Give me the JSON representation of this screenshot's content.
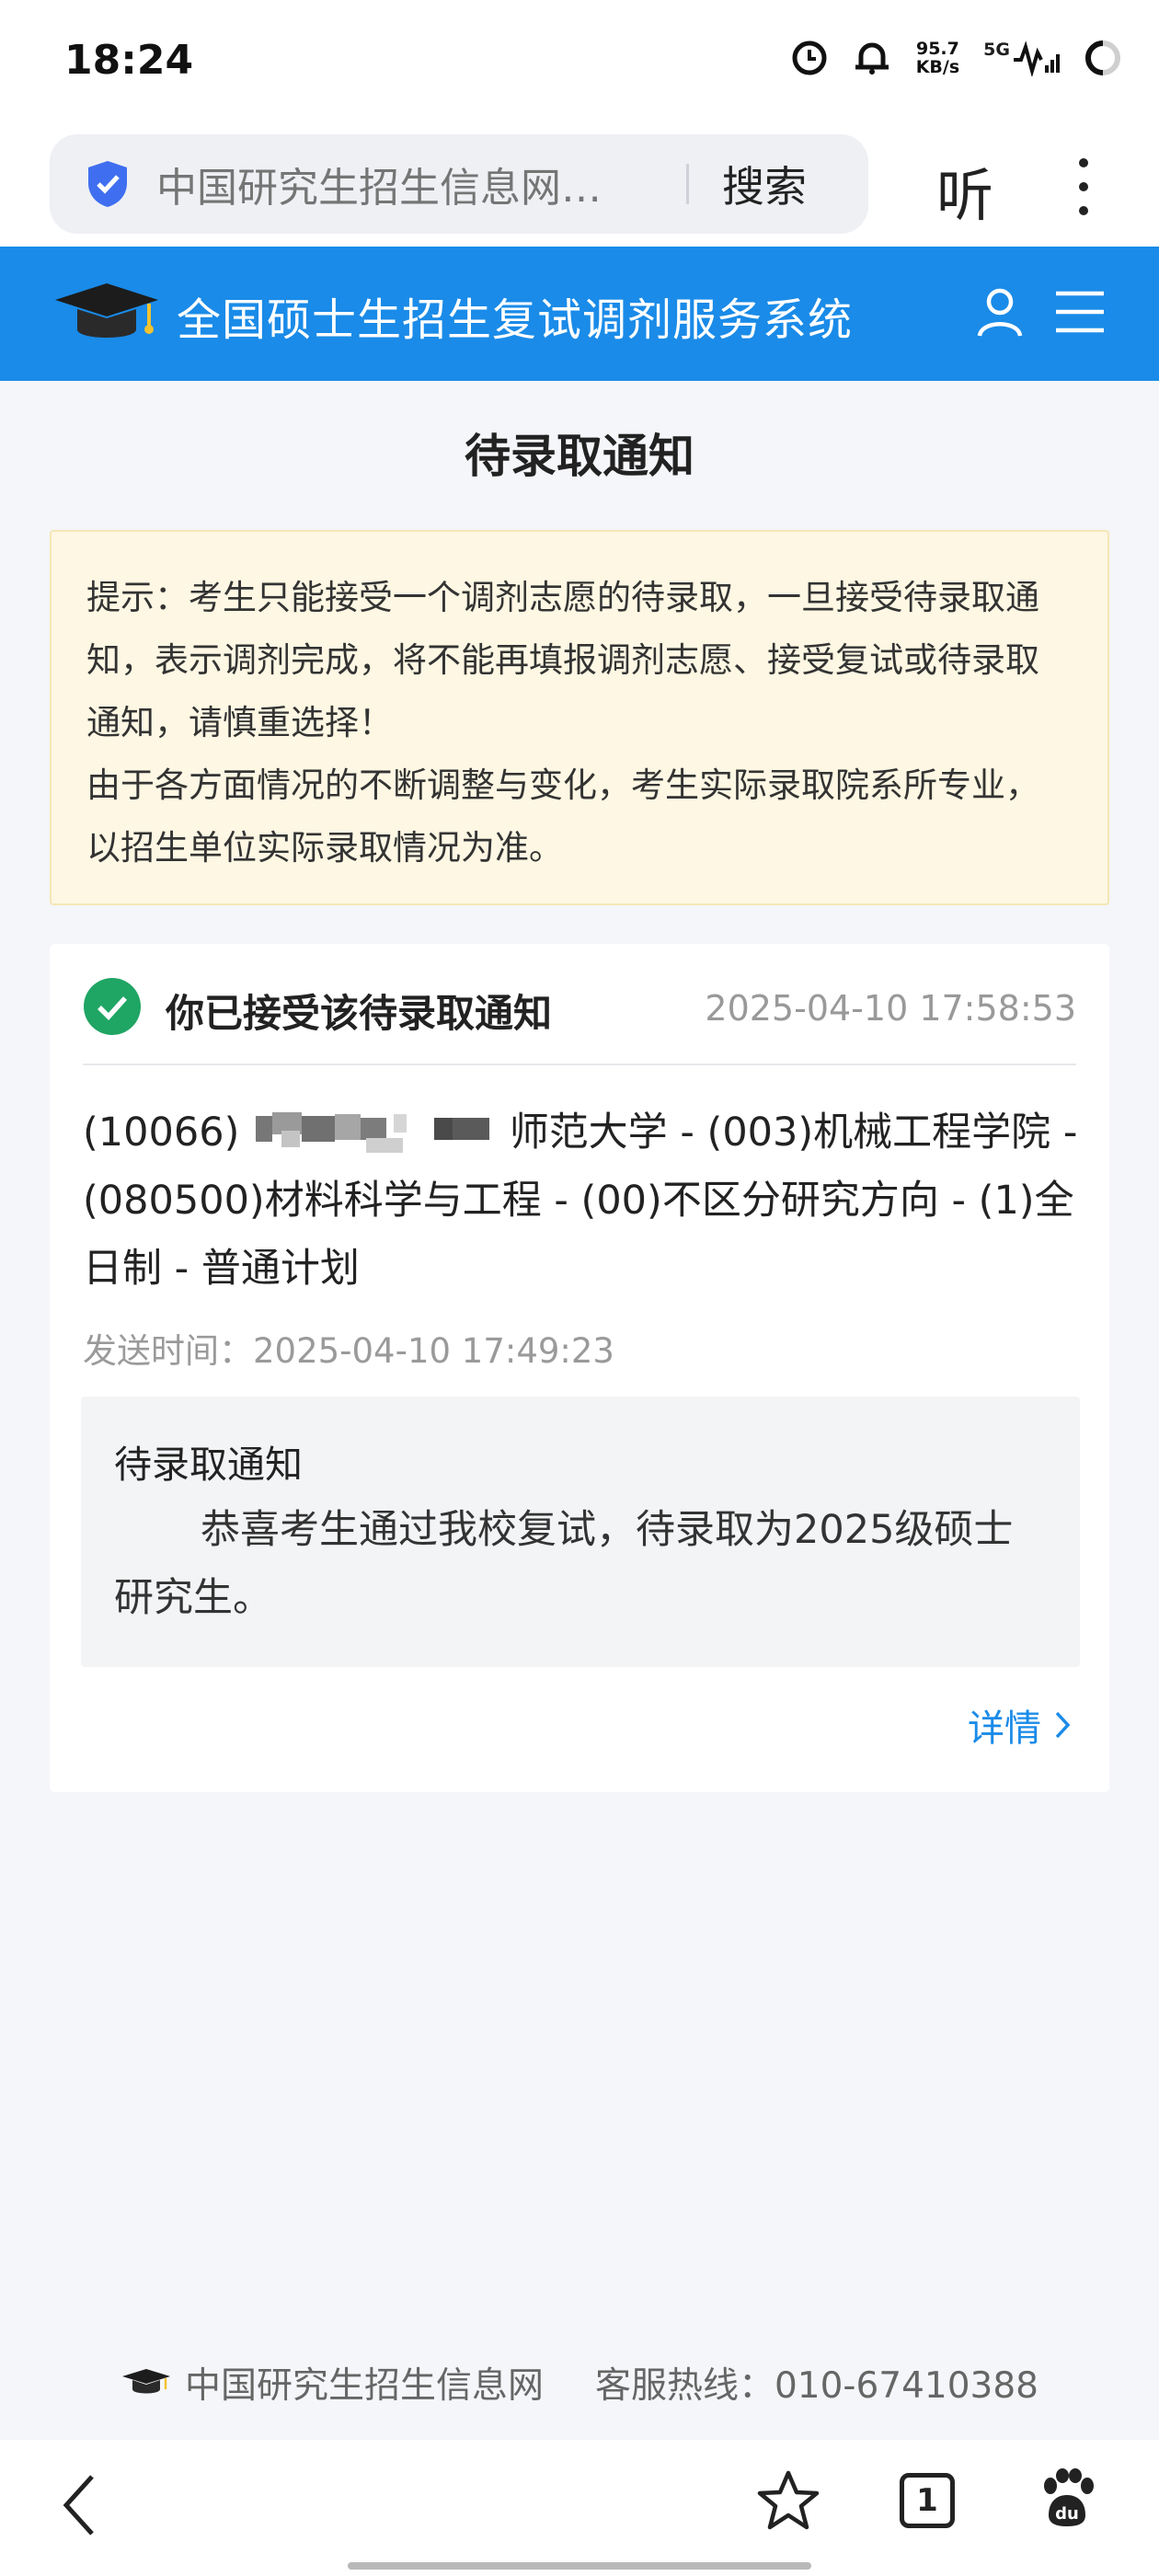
{
  "status_bar": {
    "time": "18:24",
    "net_speed_value": "95.7",
    "net_speed_unit": "KB/s",
    "network": "5G",
    "icons": [
      "clock-icon",
      "alarm-icon",
      "signal-icon",
      "battery-icon"
    ]
  },
  "browser": {
    "address_text": "中国研究生招生信息网…",
    "search_label": "搜索",
    "listen_label": "听",
    "icons": [
      "shield-icon",
      "more-icon",
      "back-icon",
      "star-icon",
      "tabs-icon",
      "paw-icon"
    ],
    "tab_count": "1"
  },
  "site": {
    "title": "全国硕士生招生复试调剂服务系统",
    "icons": [
      "graduation-cap-icon",
      "user-icon",
      "menu-icon"
    ],
    "brand_color": "#1a8be8"
  },
  "page": {
    "title": "待录取通知",
    "notice": {
      "line1": "提示：考生只能接受一个调剂志愿的待录取，一旦接受待录取通知，表示调剂完成，将不能再填报调剂志愿、接受复试或待录取通知，请慎重选择！",
      "line2": "由于各方面情况的不断调整与变化，考生实际录取院系所专业，以招生单位实际录取情况为准。"
    }
  },
  "card": {
    "status": "你已接受该待录取通知",
    "status_time": "2025-04-10 17:58:53",
    "program_prefix": "(10066)",
    "program_rest": "师范大学 - (003)机械工程学院 - (080500)材料科学与工程 - (00)不区分研究方向 - (1)全日制 - 普通计划",
    "send_time": "发送时间：2025-04-10 17:49:23",
    "notice_title": "待录取通知",
    "notice_body": "恭喜考生通过我校复试，待录取为2025级硕士研究生。",
    "details_label": "详情"
  },
  "footer": {
    "site_name": "中国研究生招生信息网",
    "hotline": "客服热线：010-67410388"
  }
}
